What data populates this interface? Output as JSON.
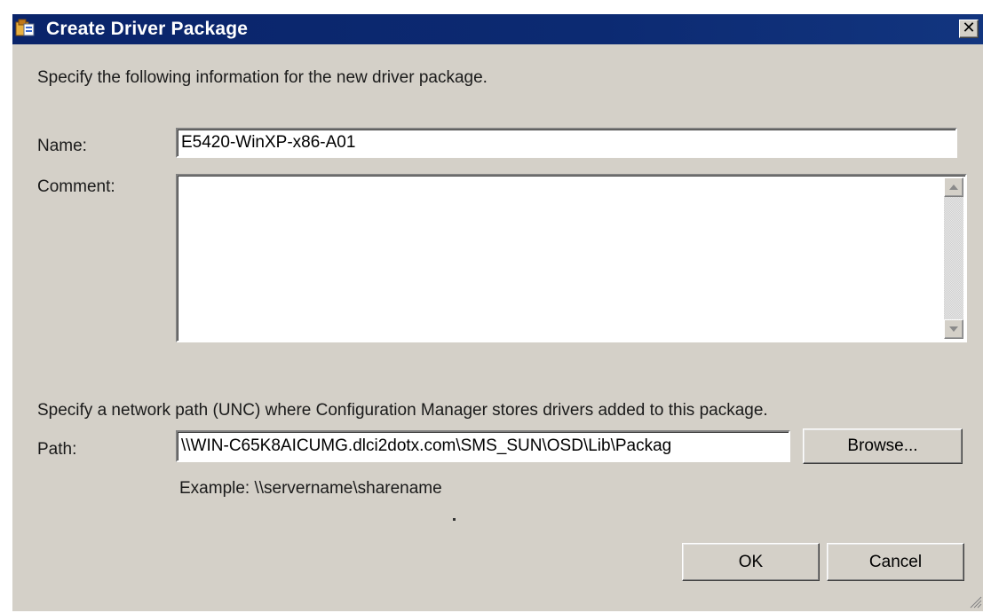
{
  "window": {
    "title": "Create Driver Package",
    "close_glyph": "✕",
    "icon": "package-icon"
  },
  "intro_text": "Specify the following information for the new driver package.",
  "name": {
    "label": "Name:",
    "value": "E5420-WinXP-x86-A01"
  },
  "comment": {
    "label": "Comment:",
    "value": ""
  },
  "path_section": {
    "instructions": "Specify a network path (UNC) where Configuration Manager stores drivers added to this package.",
    "label": "Path:",
    "value": "\\\\WIN-C65K8AICUMG.dlci2dotx.com\\SMS_SUN\\OSD\\Lib\\Packag",
    "example": "Example: \\\\servername\\sharename",
    "browse_label": "Browse..."
  },
  "buttons": {
    "ok": "OK",
    "cancel": "Cancel"
  },
  "colors": {
    "titlebar": "#0a246a",
    "dialog_face": "#d4d0c8",
    "title_text": "#ffffff"
  }
}
